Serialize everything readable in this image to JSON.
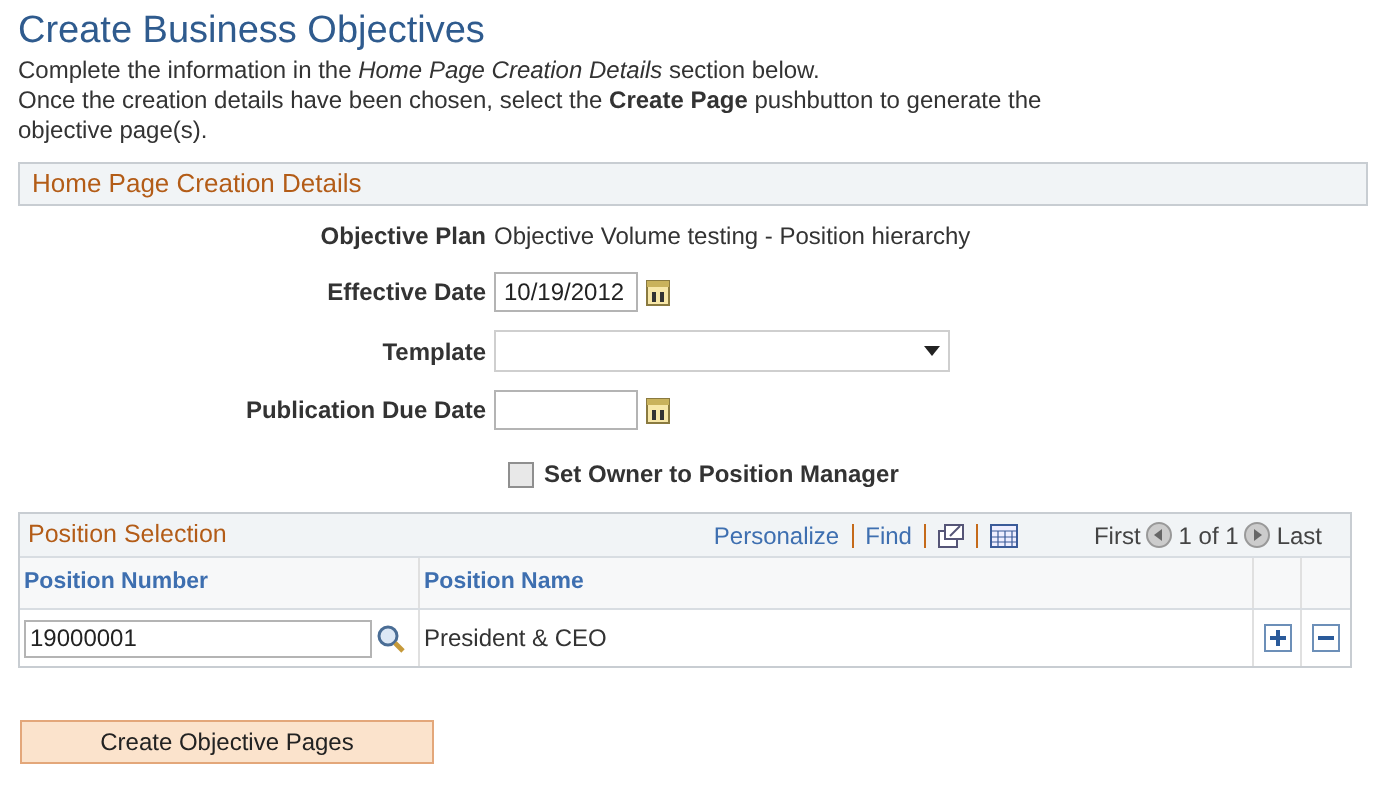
{
  "title": "Create Business Objectives",
  "instructions": [
    "Complete the information in the *Home Page Creation Details* section below.",
    "Once the creation details have been chosen, select the **Create Page** pushbutton to generate the objective page(s)."
  ],
  "details": {
    "heading": "Home Page Creation Details",
    "fields": [
      {
        "kind": "text",
        "label": "Objective Plan",
        "value": "Objective Volume testing - Position hierarchy"
      },
      {
        "kind": "date",
        "label": "Effective Date",
        "value": "10/19/2012"
      },
      {
        "kind": "select",
        "label": "Template"
      },
      {
        "kind": "date",
        "label": "Publication Due Date"
      },
      {
        "kind": "checkbox",
        "label": "Set Owner to Position Manager",
        "checked": false
      }
    ]
  },
  "grid": {
    "heading": "Position Selection",
    "links": [
      "Personalize",
      "Find"
    ],
    "nav_first": "First",
    "nav_count": "1 of 1",
    "nav_last": "Last",
    "columns": [
      "Position Number",
      "Position Name"
    ],
    "rows": [
      {
        "position_number": "19000001",
        "position_name": "President & CEO"
      }
    ]
  },
  "button": "Create Objective Pages"
}
